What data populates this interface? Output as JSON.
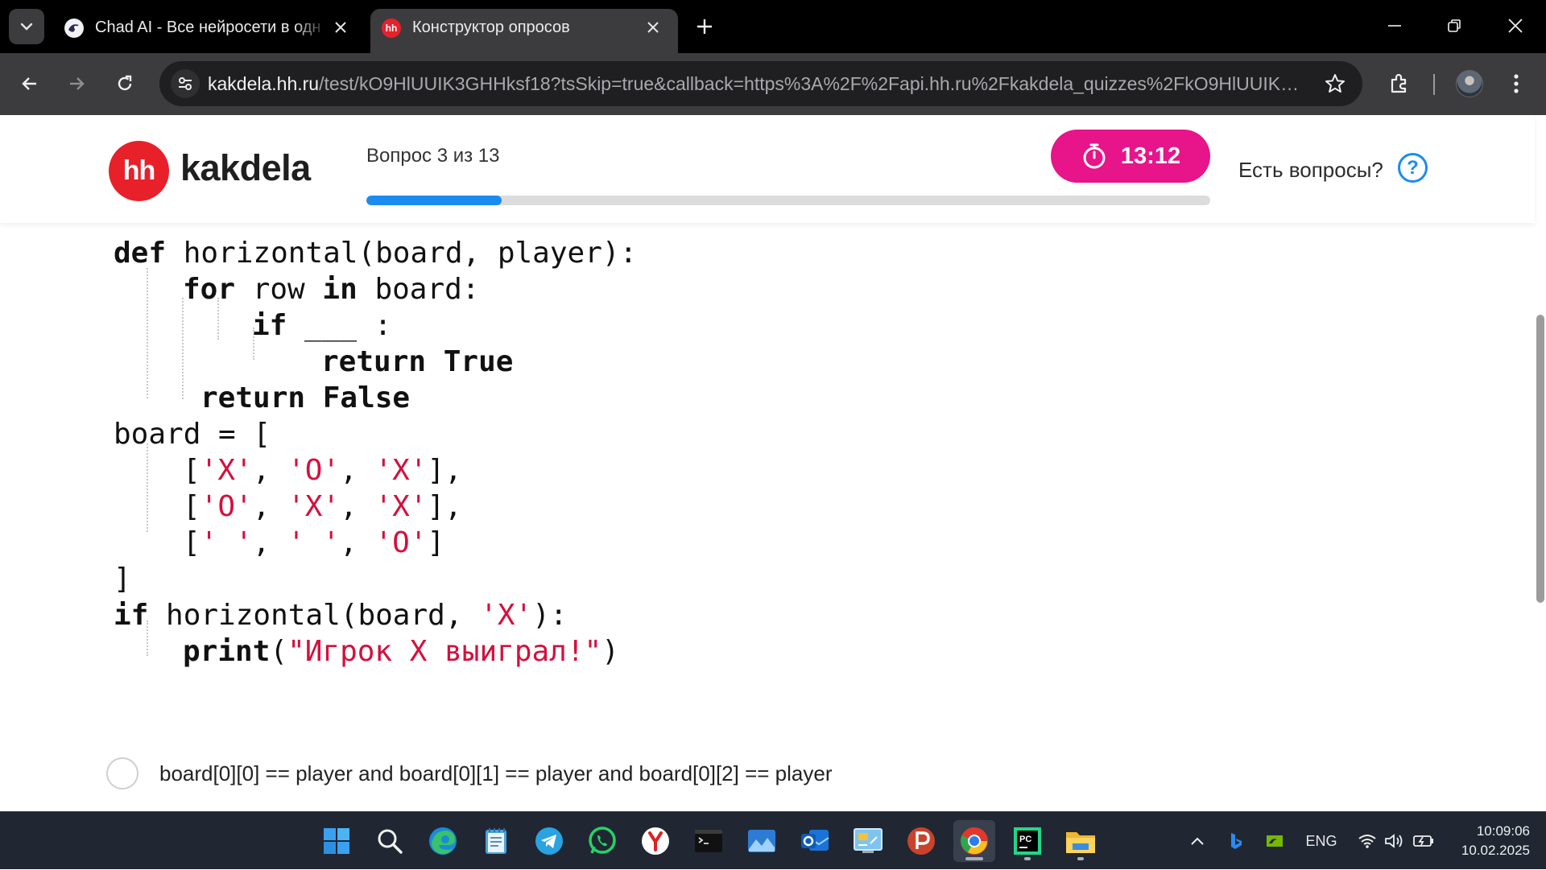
{
  "tabs": [
    {
      "title": "Chad AI - Все нейросети в одн"
    },
    {
      "title": "Конструктор опросов",
      "favicon_text": "hh"
    }
  ],
  "toolbar": {
    "url_host": "kakdela.hh.ru",
    "url_path": "/test/kO9HlUUIK3GHHksf18?tsSkip=true&callback=https%3A%2F%2Fapi.hh.ru%2Fkakdela_quizzes%2FkO9HlUUIK3GH..."
  },
  "header": {
    "logo_text": "hh",
    "brand": "kakdela",
    "question_counter": "Вопрос 3 из 13",
    "progress": 0.16,
    "timer": "13:12",
    "help_text": "Есть вопросы?",
    "help_icon": "?"
  },
  "code": {
    "lines": [
      [
        {
          "t": "def",
          "c": "kw"
        },
        {
          "t": " horizontal(board, player):"
        }
      ],
      [
        {
          "t": "for",
          "c": "kw"
        },
        {
          "t": " row "
        },
        {
          "t": "in",
          "c": "kw"
        },
        {
          "t": " board:"
        }
      ],
      [
        {
          "t": "if",
          "c": "kw"
        },
        {
          "t": " ___ :"
        }
      ],
      [
        {
          "t": "return",
          "c": "kw"
        },
        {
          "t": " "
        },
        {
          "t": "True",
          "c": "kw"
        }
      ],
      [
        {
          "t": "return",
          "c": "kw"
        },
        {
          "t": " "
        },
        {
          "t": "False",
          "c": "kw"
        }
      ],
      [
        {
          "t": "board = ["
        }
      ],
      [
        {
          "t": "["
        },
        {
          "t": "'X'",
          "c": "str"
        },
        {
          "t": ", "
        },
        {
          "t": "'O'",
          "c": "str"
        },
        {
          "t": ", "
        },
        {
          "t": "'X'",
          "c": "str"
        },
        {
          "t": "],"
        }
      ],
      [
        {
          "t": "["
        },
        {
          "t": "'O'",
          "c": "str"
        },
        {
          "t": ", "
        },
        {
          "t": "'X'",
          "c": "str"
        },
        {
          "t": ", "
        },
        {
          "t": "'X'",
          "c": "str"
        },
        {
          "t": "],"
        }
      ],
      [
        {
          "t": "["
        },
        {
          "t": "' '",
          "c": "str"
        },
        {
          "t": ", "
        },
        {
          "t": "' '",
          "c": "str"
        },
        {
          "t": ", "
        },
        {
          "t": "'O'",
          "c": "str"
        },
        {
          "t": "]"
        }
      ],
      [
        {
          "t": "]"
        }
      ],
      [
        {
          "t": "if",
          "c": "kw"
        },
        {
          "t": " horizontal(board, "
        },
        {
          "t": "'X'",
          "c": "str"
        },
        {
          "t": "):"
        }
      ],
      [
        {
          "t": "print",
          "c": "kw"
        },
        {
          "t": "("
        },
        {
          "t": "\"Игрок X выиграл!\"",
          "c": "str"
        },
        {
          "t": ")"
        }
      ]
    ]
  },
  "answer": {
    "option_1": "board[0][0] == player and board[0][1] == player and board[0][2] == player"
  },
  "taskbar": {
    "apps": [
      "start-icon",
      "search-icon",
      "edge-icon",
      "notepad-icon",
      "telegram-icon",
      "whatsapp-icon",
      "yandex-browser-icon",
      "terminal-icon",
      "photos-icon",
      "outlook-icon",
      "control-panel-icon",
      "powerpoint-icon",
      "chrome-icon",
      "pycharm-icon",
      "file-explorer-icon"
    ],
    "active_app": "chrome-icon",
    "language": "ENG",
    "time": "10:09:06",
    "date": "10.02.2025"
  },
  "colors": {
    "accent_blue": "#1a8cf0",
    "timer_pink": "#e7148a",
    "hh_red": "#e8202a",
    "code_string": "#d4103c"
  }
}
